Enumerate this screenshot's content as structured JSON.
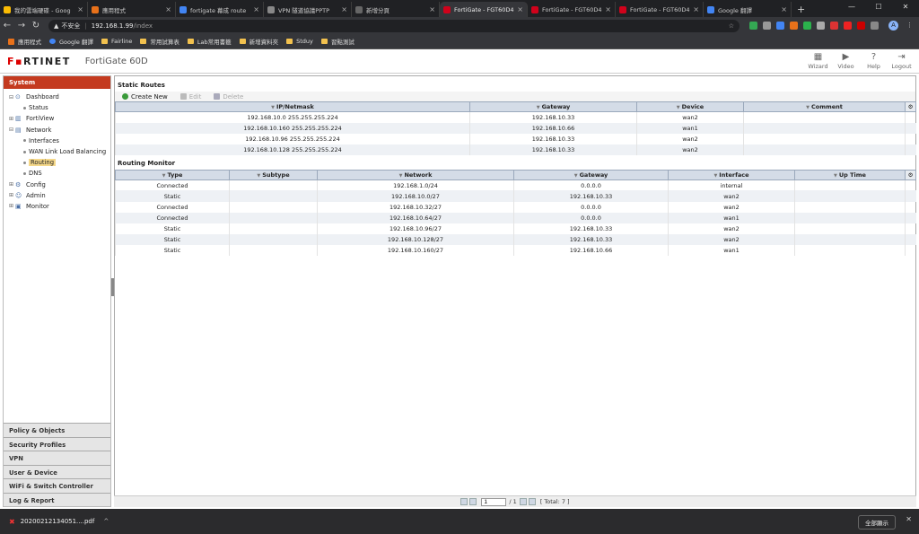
{
  "browser": {
    "tabs": [
      {
        "label": "我的雲端硬碟 - Goog",
        "color": "#fbbc04",
        "active": false
      },
      {
        "label": "應用程式",
        "color": "#e8711a",
        "active": false
      },
      {
        "label": "fortigate 幕成 route",
        "color": "#4285f4",
        "active": false
      },
      {
        "label": "VPN 隧道協議PPTP",
        "color": "#888888",
        "active": false
      },
      {
        "label": "新增分頁",
        "color": "#666666",
        "active": false
      },
      {
        "label": "FortiGate - FGT60D4",
        "color": "#d0021b",
        "active": true
      },
      {
        "label": "FortiGate - FGT60D4",
        "color": "#d0021b",
        "active": false
      },
      {
        "label": "FortiGate - FGT60D4",
        "color": "#d0021b",
        "active": false
      },
      {
        "label": "Google 翻譯",
        "color": "#4285f4",
        "active": false
      }
    ],
    "new_tab": "+",
    "window_controls": [
      "—",
      "☐",
      "✕"
    ],
    "security": "不安全",
    "host": "192.168.1.99",
    "path": "/index",
    "profile": "A",
    "bookmarks": [
      {
        "label": "應用程式",
        "icon": "apps"
      },
      {
        "label": "Google 翻譯",
        "icon": "g"
      },
      {
        "label": "Fairline",
        "icon": "folder"
      },
      {
        "label": "常用試算表",
        "icon": "folder"
      },
      {
        "label": "Lab常用書籤",
        "icon": "folder"
      },
      {
        "label": "新增資料夾",
        "icon": "folder"
      },
      {
        "label": "Stduy",
        "icon": "folder"
      },
      {
        "label": "習點測試",
        "icon": "folder"
      }
    ]
  },
  "header": {
    "logo": "F",
    "logo_rest": "RTINET",
    "model": "FortiGate 60D",
    "buttons": [
      {
        "label": "Wizard",
        "icon": "wizard-icon",
        "glyph": "▦"
      },
      {
        "label": "Video",
        "icon": "video-icon",
        "glyph": "▶"
      },
      {
        "label": "Help",
        "icon": "help-icon",
        "glyph": "?"
      },
      {
        "label": "Logout",
        "icon": "logout-icon",
        "glyph": "⇥"
      }
    ]
  },
  "sidebar": {
    "title": "System",
    "tree": [
      {
        "label": "Dashboard",
        "level": 0,
        "pm": "⊟",
        "icon": "⊙",
        "selected": false
      },
      {
        "label": "Status",
        "level": 1,
        "pm": "",
        "icon": "",
        "selected": false
      },
      {
        "label": "FortiView",
        "level": 0,
        "pm": "⊞",
        "icon": "▥",
        "selected": false
      },
      {
        "label": "Network",
        "level": 0,
        "pm": "⊟",
        "icon": "▤",
        "selected": false
      },
      {
        "label": "Interfaces",
        "level": 1,
        "pm": "",
        "icon": "",
        "selected": false
      },
      {
        "label": "WAN Link Load Balancing",
        "level": 1,
        "pm": "",
        "icon": "",
        "selected": false
      },
      {
        "label": "Routing",
        "level": 1,
        "pm": "",
        "icon": "",
        "selected": true
      },
      {
        "label": "DNS",
        "level": 1,
        "pm": "",
        "icon": "",
        "selected": false
      },
      {
        "label": "Config",
        "level": 0,
        "pm": "⊞",
        "icon": "⚙",
        "selected": false
      },
      {
        "label": "Admin",
        "level": 0,
        "pm": "⊞",
        "icon": "☺",
        "selected": false
      },
      {
        "label": "Monitor",
        "level": 0,
        "pm": "⊞",
        "icon": "▣",
        "selected": false
      }
    ],
    "nav": [
      "Policy & Objects",
      "Security Profiles",
      "VPN",
      "User & Device",
      "WiFi & Switch Controller",
      "Log & Report"
    ]
  },
  "static_routes": {
    "title": "Static Routes",
    "toolbar": {
      "create": "Create New",
      "edit": "Edit",
      "delete": "Delete"
    },
    "columns": [
      "IP/Netmask",
      "Gateway",
      "Device",
      "Comment"
    ],
    "rows": [
      [
        "192.168.10.0 255.255.255.224",
        "192.168.10.33",
        "wan2",
        ""
      ],
      [
        "192.168.10.160 255.255.255.224",
        "192.168.10.66",
        "wan1",
        ""
      ],
      [
        "192.168.10.96 255.255.255.224",
        "192.168.10.33",
        "wan2",
        ""
      ],
      [
        "192.168.10.128 255.255.255.224",
        "192.168.10.33",
        "wan2",
        ""
      ]
    ]
  },
  "routing_monitor": {
    "title": "Routing Monitor",
    "columns": [
      "Type",
      "Subtype",
      "Network",
      "Gateway",
      "Interface",
      "Up Time"
    ],
    "rows": [
      [
        "Connected",
        "",
        "192.168.1.0/24",
        "0.0.0.0",
        "internal",
        ""
      ],
      [
        "Static",
        "",
        "192.168.10.0/27",
        "192.168.10.33",
        "wan2",
        ""
      ],
      [
        "Connected",
        "",
        "192.168.10.32/27",
        "0.0.0.0",
        "wan2",
        ""
      ],
      [
        "Connected",
        "",
        "192.168.10.64/27",
        "0.0.0.0",
        "wan1",
        ""
      ],
      [
        "Static",
        "",
        "192.168.10.96/27",
        "192.168.10.33",
        "wan2",
        ""
      ],
      [
        "Static",
        "",
        "192.168.10.128/27",
        "192.168.10.33",
        "wan2",
        ""
      ],
      [
        "Static",
        "",
        "192.168.10.160/27",
        "192.168.10.66",
        "wan1",
        ""
      ]
    ]
  },
  "pager": {
    "page": "1",
    "of": "/ 1",
    "total": "[ Total: 7 ]"
  },
  "download": {
    "file": "20200212134051....pdf",
    "show_all": "全部顯示"
  }
}
